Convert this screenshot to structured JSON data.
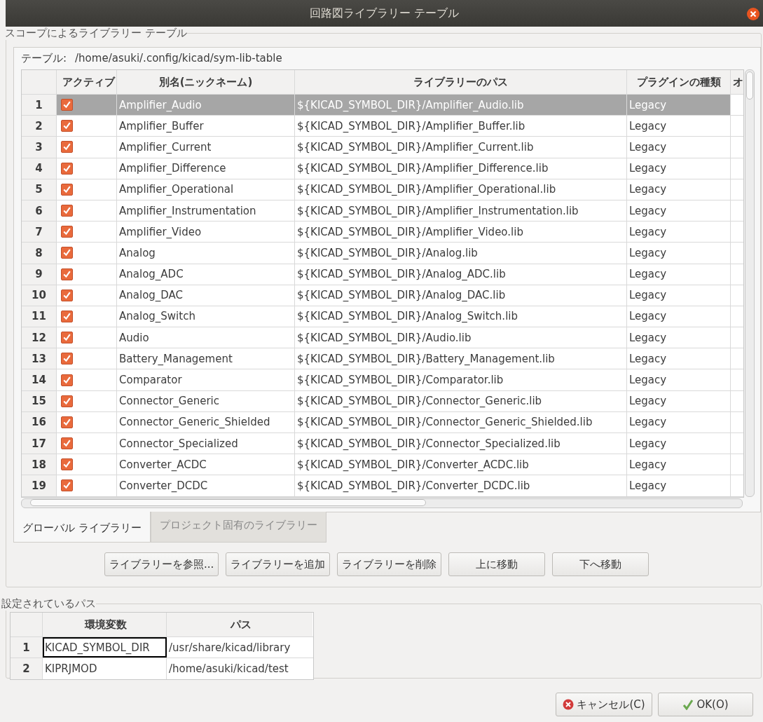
{
  "window": {
    "title": "回路図ライブラリー テーブル"
  },
  "scope_group": {
    "title": "スコープによるライブラリー テーブル",
    "table_label": "テーブル:",
    "table_path": "/home/asuki/.config/kicad/sym-lib-table",
    "table": {
      "columns": [
        "アクティブ",
        "別名(ニックネーム)",
        "ライブラリーのパス",
        "プラグインの種類",
        "オ"
      ],
      "rows": [
        {
          "number": "1",
          "active": true,
          "alias": "Amplifier_Audio",
          "path": "${KICAD_SYMBOL_DIR}/Amplifier_Audio.lib",
          "plugin": "Legacy",
          "selected": true
        },
        {
          "number": "2",
          "active": true,
          "alias": "Amplifier_Buffer",
          "path": "${KICAD_SYMBOL_DIR}/Amplifier_Buffer.lib",
          "plugin": "Legacy",
          "selected": false
        },
        {
          "number": "3",
          "active": true,
          "alias": "Amplifier_Current",
          "path": "${KICAD_SYMBOL_DIR}/Amplifier_Current.lib",
          "plugin": "Legacy",
          "selected": false
        },
        {
          "number": "4",
          "active": true,
          "alias": "Amplifier_Difference",
          "path": "${KICAD_SYMBOL_DIR}/Amplifier_Difference.lib",
          "plugin": "Legacy",
          "selected": false
        },
        {
          "number": "5",
          "active": true,
          "alias": "Amplifier_Operational",
          "path": "${KICAD_SYMBOL_DIR}/Amplifier_Operational.lib",
          "plugin": "Legacy",
          "selected": false
        },
        {
          "number": "6",
          "active": true,
          "alias": "Amplifier_Instrumentation",
          "path": "${KICAD_SYMBOL_DIR}/Amplifier_Instrumentation.lib",
          "plugin": "Legacy",
          "selected": false
        },
        {
          "number": "7",
          "active": true,
          "alias": "Amplifier_Video",
          "path": "${KICAD_SYMBOL_DIR}/Amplifier_Video.lib",
          "plugin": "Legacy",
          "selected": false
        },
        {
          "number": "8",
          "active": true,
          "alias": "Analog",
          "path": "${KICAD_SYMBOL_DIR}/Analog.lib",
          "plugin": "Legacy",
          "selected": false
        },
        {
          "number": "9",
          "active": true,
          "alias": "Analog_ADC",
          "path": "${KICAD_SYMBOL_DIR}/Analog_ADC.lib",
          "plugin": "Legacy",
          "selected": false
        },
        {
          "number": "10",
          "active": true,
          "alias": "Analog_DAC",
          "path": "${KICAD_SYMBOL_DIR}/Analog_DAC.lib",
          "plugin": "Legacy",
          "selected": false
        },
        {
          "number": "11",
          "active": true,
          "alias": "Analog_Switch",
          "path": "${KICAD_SYMBOL_DIR}/Analog_Switch.lib",
          "plugin": "Legacy",
          "selected": false
        },
        {
          "number": "12",
          "active": true,
          "alias": "Audio",
          "path": "${KICAD_SYMBOL_DIR}/Audio.lib",
          "plugin": "Legacy",
          "selected": false
        },
        {
          "number": "13",
          "active": true,
          "alias": "Battery_Management",
          "path": "${KICAD_SYMBOL_DIR}/Battery_Management.lib",
          "plugin": "Legacy",
          "selected": false
        },
        {
          "number": "14",
          "active": true,
          "alias": "Comparator",
          "path": "${KICAD_SYMBOL_DIR}/Comparator.lib",
          "plugin": "Legacy",
          "selected": false
        },
        {
          "number": "15",
          "active": true,
          "alias": "Connector_Generic",
          "path": "${KICAD_SYMBOL_DIR}/Connector_Generic.lib",
          "plugin": "Legacy",
          "selected": false
        },
        {
          "number": "16",
          "active": true,
          "alias": "Connector_Generic_Shielded",
          "path": "${KICAD_SYMBOL_DIR}/Connector_Generic_Shielded.lib",
          "plugin": "Legacy",
          "selected": false
        },
        {
          "number": "17",
          "active": true,
          "alias": "Connector_Specialized",
          "path": "${KICAD_SYMBOL_DIR}/Connector_Specialized.lib",
          "plugin": "Legacy",
          "selected": false
        },
        {
          "number": "18",
          "active": true,
          "alias": "Converter_ACDC",
          "path": "${KICAD_SYMBOL_DIR}/Converter_ACDC.lib",
          "plugin": "Legacy",
          "selected": false
        },
        {
          "number": "19",
          "active": true,
          "alias": "Converter_DCDC",
          "path": "${KICAD_SYMBOL_DIR}/Converter_DCDC.lib",
          "plugin": "Legacy",
          "selected": false
        }
      ]
    },
    "tabs": [
      {
        "label": "グローバル ライブラリー",
        "selected": true
      },
      {
        "label": "プロジェクト固有のライブラリー",
        "selected": false
      }
    ],
    "buttons": [
      "ライブラリーを参照...",
      "ライブラリーを追加",
      "ライブラリーを削除",
      "上に移動",
      "下へ移動"
    ]
  },
  "paths_group": {
    "title": "設定されているパス",
    "table": {
      "columns": [
        "環境変数",
        "パス"
      ],
      "rows": [
        {
          "number": "1",
          "variable": "KICAD_SYMBOL_DIR",
          "path": "/usr/share/kicad/library",
          "selected": true
        },
        {
          "number": "2",
          "variable": "KIPRJMOD",
          "path": "/home/asuki/kicad/test",
          "selected": false
        }
      ]
    }
  },
  "footer": {
    "buttons": [
      {
        "kind": "cancel",
        "label": "キャンセル(C)"
      },
      {
        "kind": "ok",
        "label": "OK(O)"
      }
    ]
  }
}
